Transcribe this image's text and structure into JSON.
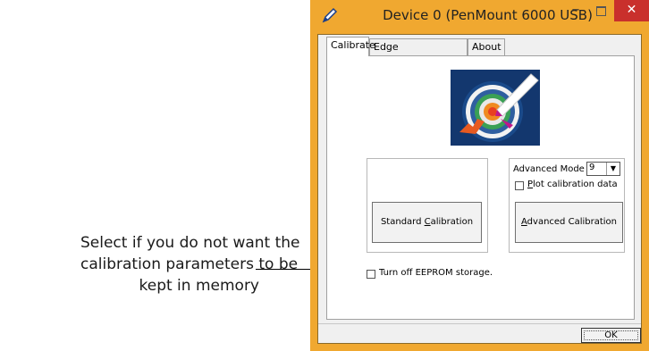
{
  "annotation": {
    "line1": "Select if you do not want the",
    "line2": "calibration parameters to be",
    "line3": "kept in memory"
  },
  "window": {
    "title": "Device 0 (PenMount 6000 USB)",
    "minimize_glyph": "–",
    "close_glyph": "✕",
    "icon": "pen-icon"
  },
  "tabs": [
    {
      "label": "Calibrate",
      "selected": true
    },
    {
      "label": "Edge Compensation",
      "selected": false
    },
    {
      "label": "About",
      "selected": false
    }
  ],
  "calibrate": {
    "image": "target-icon",
    "standard_button": {
      "pre": "Standard ",
      "mnemonic": "C",
      "post": "alibration"
    },
    "advanced_mode_label": "Advanced Mode",
    "advanced_mode_value": "9",
    "plot_checkbox": {
      "mnemonic": "P",
      "post": "lot calibration data",
      "checked": false
    },
    "advanced_button": {
      "mnemonic": "A",
      "post": "dvanced Calibration"
    },
    "eeprom_checkbox": {
      "label": "Turn off EEPROM storage.",
      "checked": false
    }
  },
  "ok_label": "OK",
  "colors": {
    "frame": "#f0a830",
    "close": "#c9302c",
    "image_bg": "#13376e"
  }
}
